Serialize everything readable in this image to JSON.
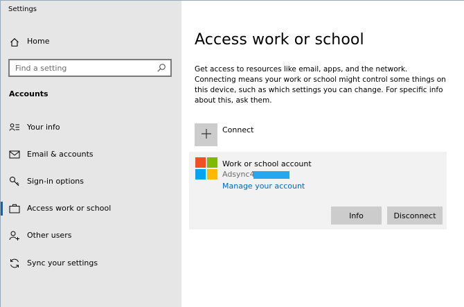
{
  "window": {
    "title": "Settings"
  },
  "sidebar": {
    "home_label": "Home",
    "search": {
      "placeholder": "Find a setting",
      "value": ""
    },
    "section_title": "Accounts",
    "items": [
      {
        "label": "Your info",
        "icon": "person-info-icon"
      },
      {
        "label": "Email & accounts",
        "icon": "mail-icon"
      },
      {
        "label": "Sign-in options",
        "icon": "key-icon"
      },
      {
        "label": "Access work or school",
        "icon": "briefcase-icon",
        "active": true
      },
      {
        "label": "Other users",
        "icon": "add-person-icon"
      },
      {
        "label": "Sync your settings",
        "icon": "sync-icon"
      }
    ]
  },
  "main": {
    "title": "Access work or school",
    "description": "Get access to resources like email, apps, and the network. Connecting means your work or school might control some things on this device, such as which settings you can change. For specific info about this, ask them.",
    "connect_label": "Connect",
    "account": {
      "title": "Work or school account",
      "email": "Adsync4@",
      "manage_link": "Manage your account",
      "info_button": "Info",
      "disconnect_button": "Disconnect"
    }
  },
  "colors": {
    "accent": "#0067c0",
    "sidebar_bg": "#e6e6e6",
    "card_bg": "#f2f2f2",
    "button_bg": "#cccccc",
    "ms_red": "#f25022",
    "ms_green": "#7fba00",
    "ms_blue": "#00a4ef",
    "ms_yellow": "#ffb900"
  }
}
